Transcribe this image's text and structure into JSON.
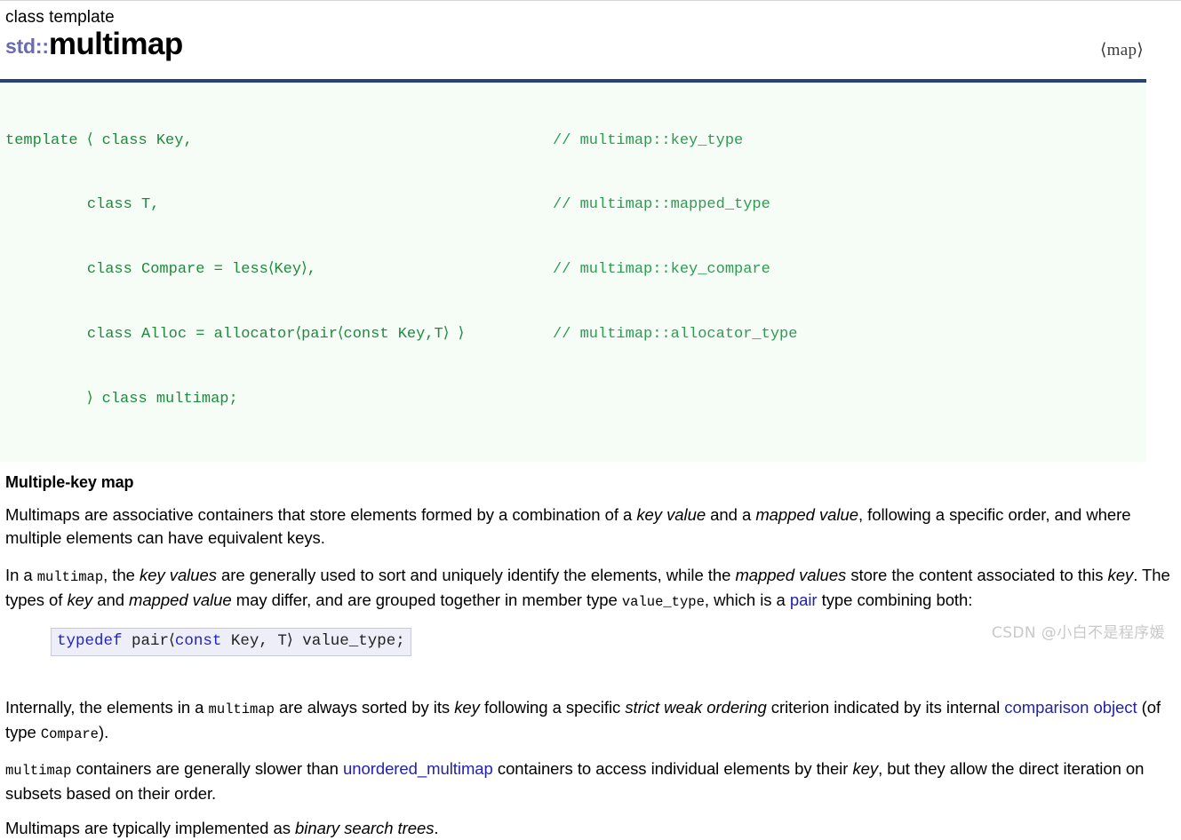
{
  "page": {
    "kicker": "class template",
    "namespace": "std::",
    "name": "multimap",
    "include_header": "⟨map⟩"
  },
  "prototype": {
    "lines": [
      {
        "code": "template ⟨ class Key,",
        "comment": "// multimap::key_type"
      },
      {
        "code": "         class T,",
        "comment": "// multimap::mapped_type"
      },
      {
        "code": "         class Compare = less⟨Key⟩,",
        "comment": "// multimap::key_compare"
      },
      {
        "code": "         class Alloc = allocator⟨pair⟨const Key,T⟩ ⟩",
        "comment": "// multimap::allocator_type"
      },
      {
        "code": "         ⟩ class multimap;",
        "comment": ""
      }
    ]
  },
  "section": {
    "heading": "Multiple-key map"
  },
  "paragraph1": {
    "t1": "Multimaps are associative containers that store elements formed by a combination of a ",
    "i1": "key value",
    "t2": " and a ",
    "i2": "mapped value",
    "t3": ", following a specific order, and where multiple elements can have equivalent keys."
  },
  "paragraph2": {
    "t1": "In a ",
    "c1": "multimap",
    "t2": ", the ",
    "i1": "key values",
    "t3": " are generally used to sort and uniquely identify the elements, while the ",
    "i2": "mapped values",
    "t4": " store the content associated to this ",
    "i3": "key",
    "t5": ". The types of ",
    "i4": "key",
    "t6": " and ",
    "i5": "mapped value",
    "t7": " may differ, and are grouped together in member type ",
    "c2": "value_type",
    "t8": ", which is a ",
    "link1": "pair",
    "t9": " type combining both:"
  },
  "sample": {
    "kw1": "typedef",
    "rest1": " pair⟨",
    "kw2": "const",
    "rest2": " Key, T⟩ value_type;"
  },
  "paragraph3": {
    "t1": "Internally, the elements in a ",
    "c1": "multimap",
    "t2": " are always sorted by its ",
    "i1": "key",
    "t3": " following a specific ",
    "i2": "strict weak ordering",
    "t4": " criterion indicated by its internal ",
    "link1": "comparison object",
    "t5": " (of type ",
    "c2": "Compare",
    "t6": ")."
  },
  "paragraph4": {
    "c1": "multimap",
    "t1": " containers are generally slower than ",
    "link1": "unordered_multimap",
    "t2": " containers to access individual elements by their ",
    "i1": "key",
    "t3": ", but they allow the direct iteration on subsets based on their order."
  },
  "paragraph5": {
    "t1": "Multimaps are typically implemented as ",
    "i1": "binary search trees",
    "t2": "."
  },
  "watermark": {
    "text": "CSDN @小白不是程序媛"
  },
  "colors": {
    "accent_rule": "#264478",
    "namespace": "#6b6bb3",
    "code_green": "#1f8a3d",
    "comment_green": "#2e9b52",
    "link_blue": "#2222aa",
    "sample_bg": "#eeeef8",
    "code_bg": "#f6fdf7"
  }
}
